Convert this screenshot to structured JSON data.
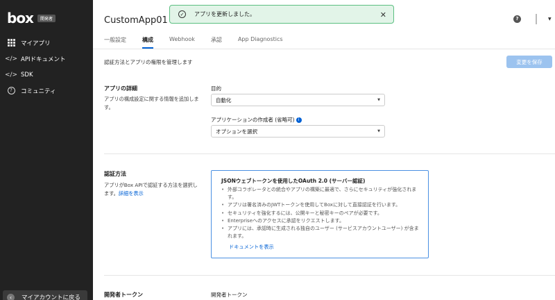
{
  "sidebar": {
    "logo": "box",
    "badge": "開発者",
    "items": [
      {
        "label": "マイアプリ",
        "icon": "grid-icon"
      },
      {
        "label": "APIドキュメント",
        "icon": "code-icon"
      },
      {
        "label": "SDK",
        "icon": "code-icon"
      },
      {
        "label": "コミュニティ",
        "icon": "question-icon"
      }
    ],
    "account_label": "マイアカウントに戻る"
  },
  "header": {
    "app_title": "CustomApp01",
    "toast_message": "アプリを更新しました。",
    "help_glyph": "?"
  },
  "tabs": [
    "一般設定",
    "構成",
    "Webhook",
    "承認",
    "App Diagnostics"
  ],
  "active_tab": "構成",
  "page": {
    "description": "認証方法とアプリの権限を管理します",
    "save_label": "変更を保存"
  },
  "app_details": {
    "title": "アプリの詳細",
    "description": "アプリの構成設定に関する情報を追加します。",
    "purpose_label": "目的",
    "purpose_value": "自動化",
    "creator_label": "アプリケーションの作成者 (省略可)",
    "creator_value": "オプションを選択"
  },
  "auth": {
    "title": "認証方法",
    "description": "アプリがBox APIで認証する方法を選択します。",
    "details_link": "詳細を表示",
    "box_title": "JSONウェブトークンを使用したOAuth 2.0 (サーバー認証)",
    "bullets": [
      "外部コラボレータとの統合やアプリの構築に最適で、さらにセキュリティが強化されます。",
      "アプリは署名済みのJWTトークンを使用してBoxに対して直接認証を行います。",
      "セキュリティを強化するには、公開キーと秘密キーのペアが必要です。",
      "Enterpriseへのアクセスに承認をリクエストします。",
      "アプリには、承認時に生成される独自のユーザー (サービスアカウントユーザー) が含まれます。"
    ],
    "doc_link": "ドキュメントを表示"
  },
  "dev_token": {
    "title": "開発者トークン",
    "field_label": "開発者トークン"
  },
  "colors": {
    "sidebar_bg": "#222222",
    "accent": "#0061d5",
    "toast_bg": "#e2f4e8",
    "toast_border": "#5bbf80",
    "save_disabled": "#9cc3ef"
  }
}
